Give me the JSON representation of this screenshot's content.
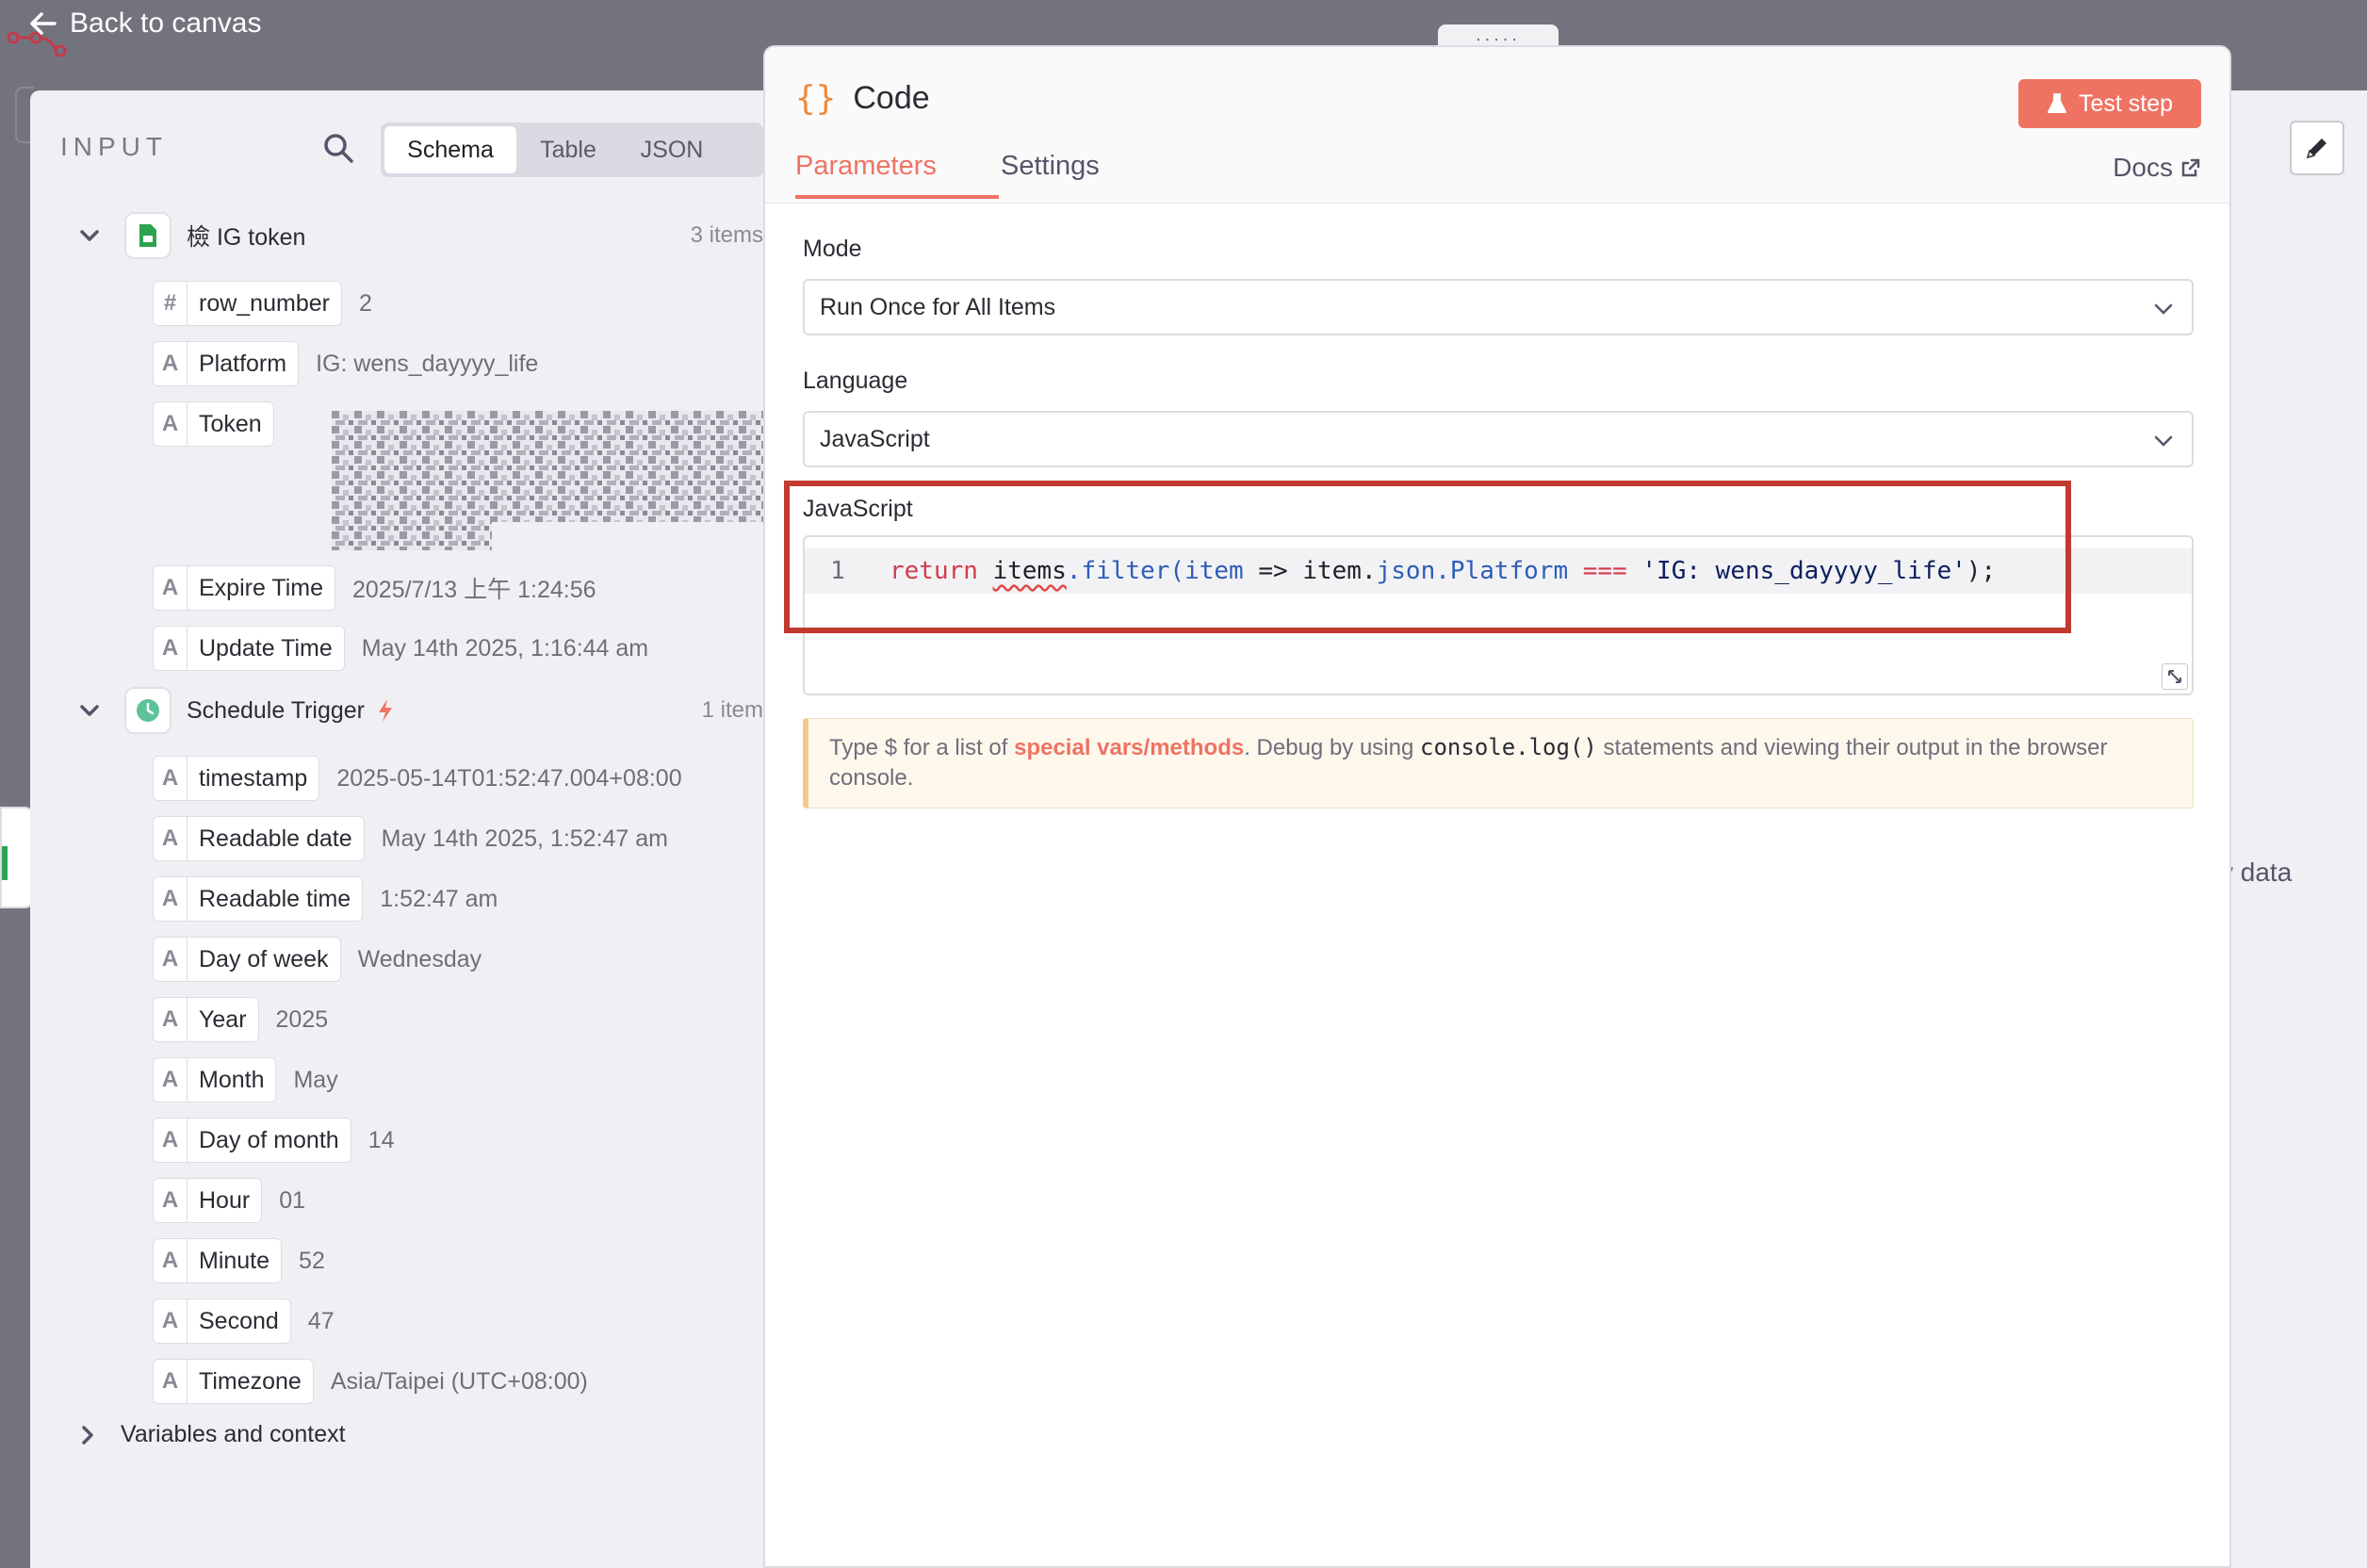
{
  "topbar": {
    "back_label": "Back to canvas",
    "drag_handle": ":::::"
  },
  "input_panel": {
    "title": "INPUT",
    "view_tabs": [
      "Schema",
      "Table",
      "JSON"
    ],
    "active_view": "Schema",
    "groups": [
      {
        "label": "檢 IG token",
        "count": "3 items",
        "icon": "google-sheets-icon",
        "fields": [
          {
            "type": "#",
            "name": "row_number",
            "value": "2"
          },
          {
            "type": "A",
            "name": "Platform",
            "value": "IG: wens_dayyyy_life"
          },
          {
            "type": "A",
            "name": "Token",
            "value": ""
          },
          {
            "type": "A",
            "name": "Expire Time",
            "value": "2025/7/13 上午 1:24:56"
          },
          {
            "type": "A",
            "name": "Update Time",
            "value": "May 14th 2025, 1:16:44 am"
          }
        ]
      },
      {
        "label": "Schedule Trigger",
        "count": "1 item",
        "icon": "clock-icon",
        "fields": [
          {
            "type": "A",
            "name": "timestamp",
            "value": "2025-05-14T01:52:47.004+08:00"
          },
          {
            "type": "A",
            "name": "Readable date",
            "value": "May 14th 2025, 1:52:47 am"
          },
          {
            "type": "A",
            "name": "Readable time",
            "value": "1:52:47 am"
          },
          {
            "type": "A",
            "name": "Day of week",
            "value": "Wednesday"
          },
          {
            "type": "A",
            "name": "Year",
            "value": "2025"
          },
          {
            "type": "A",
            "name": "Month",
            "value": "May"
          },
          {
            "type": "A",
            "name": "Day of month",
            "value": "14"
          },
          {
            "type": "A",
            "name": "Hour",
            "value": "01"
          },
          {
            "type": "A",
            "name": "Minute",
            "value": "52"
          },
          {
            "type": "A",
            "name": "Second",
            "value": "47"
          },
          {
            "type": "A",
            "name": "Timezone",
            "value": "Asia/Taipei (UTC+08:00)"
          }
        ]
      }
    ],
    "variables_label": "Variables and context"
  },
  "code_panel": {
    "title": "Code",
    "test_button": "Test step",
    "tabs": [
      "Parameters",
      "Settings"
    ],
    "active_tab": "Parameters",
    "docs_label": "Docs",
    "mode": {
      "label": "Mode",
      "value": "Run Once for All Items"
    },
    "language": {
      "label": "Language",
      "value": "JavaScript"
    },
    "editor": {
      "label": "JavaScript",
      "line_number": "1",
      "code": {
        "kw_return": "return",
        "ident_items": "items",
        "method_filter": ".filter(",
        "param_item": "item",
        "arrow": " => ",
        "item_ref": "item.",
        "prop_json": "json.Platform",
        "op_eq": " === ",
        "str_val": "'IG: wens_dayyyy_life'",
        "tail": ");"
      }
    },
    "hint": {
      "prefix": "Type $ for a list of ",
      "link": "special vars/methods",
      "middle": ". Debug by using ",
      "code": "console.log()",
      "suffix": " statements and viewing their output in the browser console."
    }
  },
  "right_panel": {
    "partial_text": "v data"
  },
  "colors": {
    "accent": "#ef7363",
    "highlight_border": "#c23a2f",
    "background": "#73737e"
  }
}
